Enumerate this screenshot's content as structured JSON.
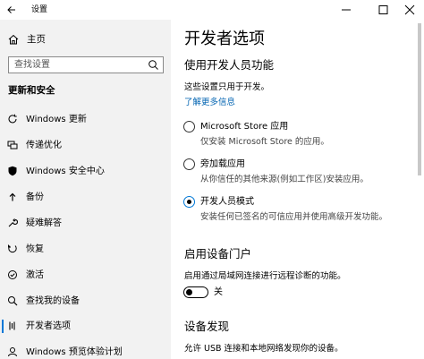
{
  "window": {
    "title": "设置"
  },
  "sidebar": {
    "home": "主页",
    "search_placeholder": "查找设置",
    "section_heading": "更新和安全",
    "items": [
      {
        "label": "Windows 更新",
        "icon": "sync-icon"
      },
      {
        "label": "传递优化",
        "icon": "delivery-optimization-icon"
      },
      {
        "label": "Windows 安全中心",
        "icon": "shield-icon"
      },
      {
        "label": "备份",
        "icon": "backup-icon"
      },
      {
        "label": "疑难解答",
        "icon": "wrench-icon"
      },
      {
        "label": "恢复",
        "icon": "recovery-icon"
      },
      {
        "label": "激活",
        "icon": "activation-icon"
      },
      {
        "label": "查找我的设备",
        "icon": "find-device-icon"
      },
      {
        "label": "开发者选项",
        "icon": "developer-icon",
        "active": true
      },
      {
        "label": "Windows 预览体验计划",
        "icon": "insider-icon"
      }
    ]
  },
  "main": {
    "title": "开发者选项",
    "section1": {
      "heading": "使用开发人员功能",
      "desc": "这些设置只用于开发。",
      "link": "了解更多信息",
      "options": [
        {
          "label": "Microsoft Store 应用",
          "desc": "仅安装 Microsoft Store 的应用。",
          "selected": false
        },
        {
          "label": "旁加载应用",
          "desc": "从你信任的其他来源(例如工作区)安装应用。",
          "selected": false
        },
        {
          "label": "开发人员模式",
          "desc": "安装任何已签名的可信应用并使用高级开发功能。",
          "selected": true
        }
      ]
    },
    "section2": {
      "heading": "启用设备门户",
      "desc": "启用通过局域网连接进行远程诊断的功能。",
      "toggle_label": "关",
      "toggle_on": false
    },
    "section3": {
      "heading": "设备发现",
      "desc": "允许 USB 连接和本地网络发现你的设备。"
    }
  },
  "colors": {
    "accent": "#0078d7",
    "link": "#0063b1",
    "sidebar_bg": "#f2f2f2"
  }
}
